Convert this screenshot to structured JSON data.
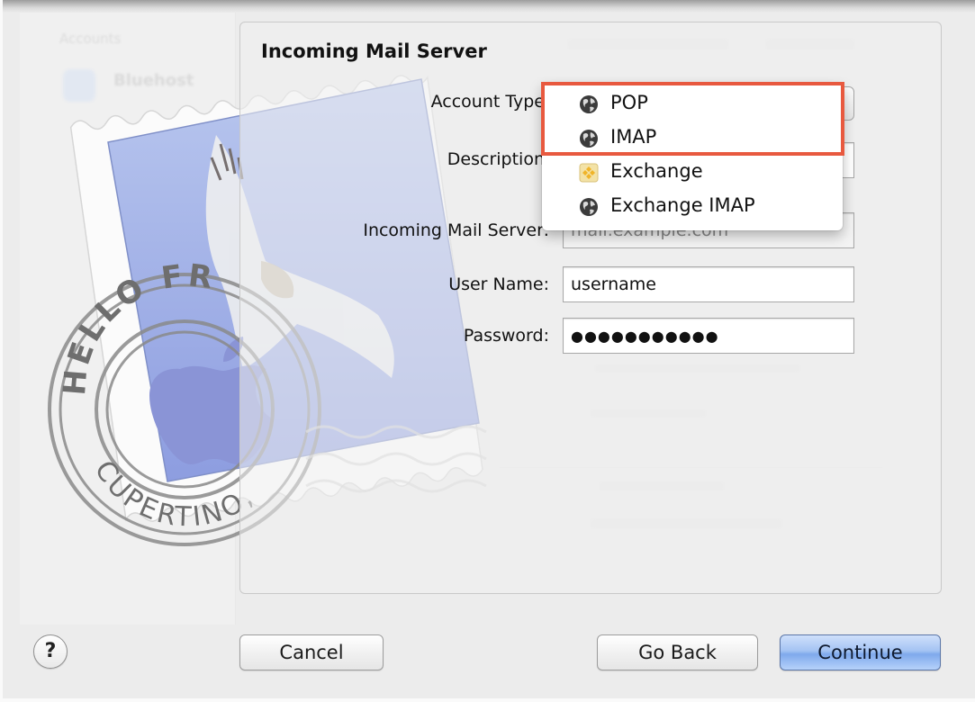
{
  "background_window": {
    "sidebar_title": "Accounts",
    "account_name": "Bluehost"
  },
  "sheet": {
    "title": "Incoming Mail Server",
    "fields": {
      "account_type": {
        "label": "Account Type"
      },
      "description": {
        "label": "Description",
        "value": ""
      },
      "incoming_server": {
        "label": "Incoming Mail Server:",
        "placeholder": "mail.example.com"
      },
      "user_name": {
        "label": "User Name:",
        "value": "username"
      },
      "password": {
        "label": "Password:",
        "masked_value": "●●●●●●●●●●●",
        "length": 11
      }
    }
  },
  "account_type_menu": {
    "items": [
      {
        "label": "POP",
        "icon": "globe-icon"
      },
      {
        "label": "IMAP",
        "icon": "globe-icon"
      },
      {
        "label": "Exchange",
        "icon": "exchange-icon"
      },
      {
        "label": "Exchange IMAP",
        "icon": "globe-icon"
      }
    ],
    "highlighted_items": [
      "POP",
      "IMAP"
    ],
    "highlight_color": "#e8593f"
  },
  "buttons": {
    "help": "?",
    "cancel": "Cancel",
    "go_back": "Go Back",
    "continue": "Continue"
  },
  "stamp": {
    "postmark_top": "HELLO FR",
    "postmark_bottom": "CUPERTINO, CA"
  },
  "colors": {
    "default_button": "#8fb3ef",
    "highlight": "#e8593f"
  }
}
